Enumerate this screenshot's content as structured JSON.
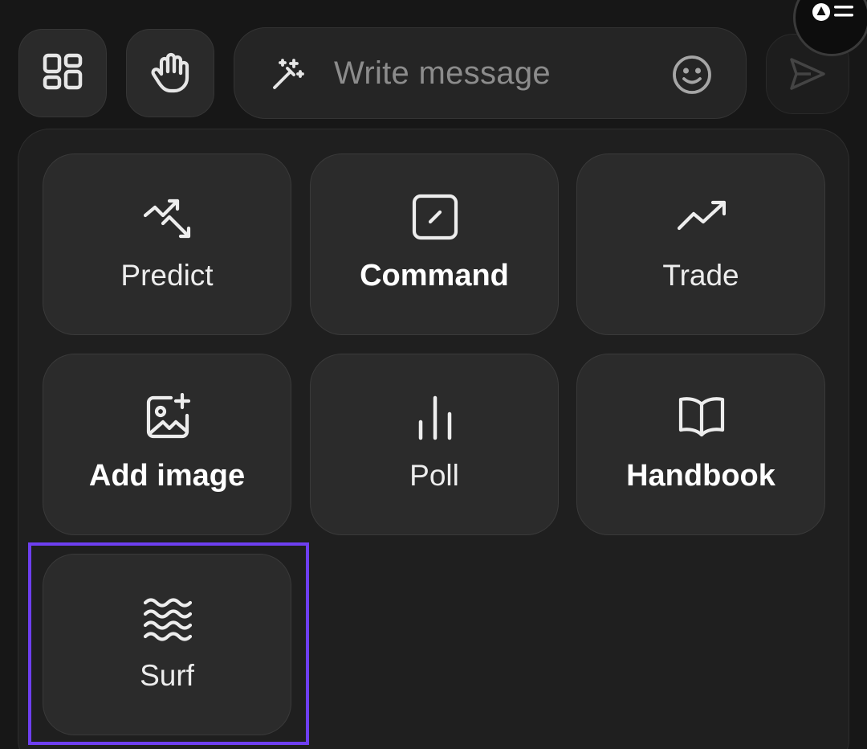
{
  "composer": {
    "placeholder": "Write message"
  },
  "icons": {
    "apps": "apps-grid-icon",
    "hand": "raise-hand-icon",
    "magic": "magic-wand-icon",
    "emoji": "emoji-smile-icon",
    "send": "send-icon",
    "avatar": "profile-menu-icon"
  },
  "actions": [
    {
      "label": "Predict",
      "icon": "trend-up-down-icon",
      "bold": false
    },
    {
      "label": "Command",
      "icon": "command-square-icon",
      "bold": true
    },
    {
      "label": "Trade",
      "icon": "trend-up-icon",
      "bold": false
    },
    {
      "label": "Add image",
      "icon": "image-add-icon",
      "bold": true
    },
    {
      "label": "Poll",
      "icon": "poll-bars-icon",
      "bold": false
    },
    {
      "label": "Handbook",
      "icon": "book-icon",
      "bold": true
    },
    {
      "label": "Surf",
      "icon": "waves-icon",
      "bold": false
    }
  ],
  "colors": {
    "background": "#171717",
    "tile": "#2b2b2b",
    "highlight": "#6e3ff0",
    "text": "#ededed",
    "placeholder": "#8c8c8c"
  }
}
